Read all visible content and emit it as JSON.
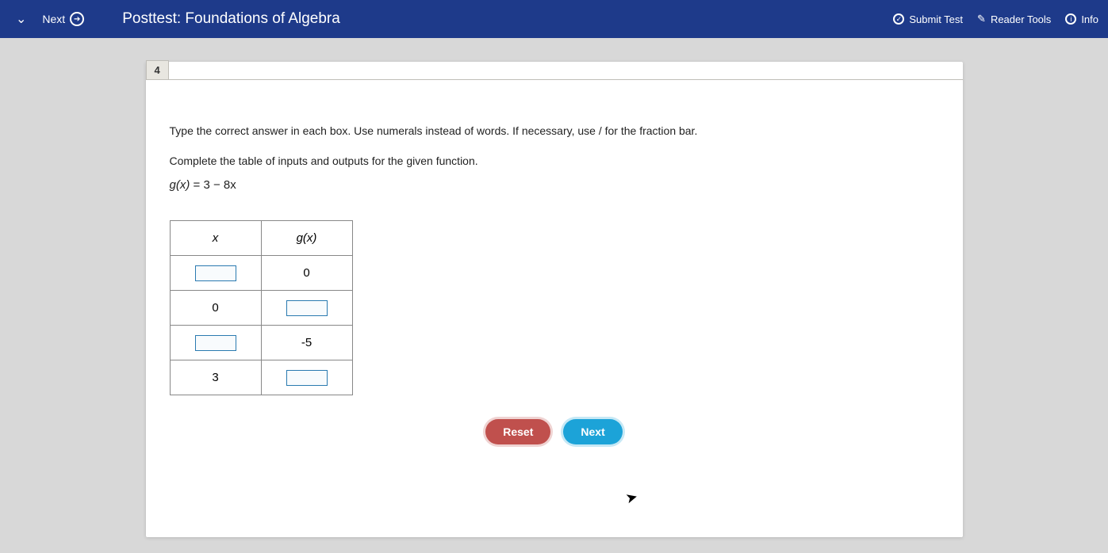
{
  "topbar": {
    "next_label": "Next",
    "title": "Posttest: Foundations of Algebra",
    "submit": "Submit Test",
    "reader": "Reader Tools",
    "info": "Info"
  },
  "question": {
    "number": "4",
    "instructions": "Type the correct answer in each box. Use numerals instead of words. If necessary, use / for the fraction bar.",
    "prompt": "Complete the table of inputs and outputs for the given function.",
    "formula_lhs": "g(x)",
    "formula_eq": " = ",
    "formula_rhs": "3 − 8x",
    "table": {
      "header_x": "x",
      "header_gx": "g(x)",
      "rows": [
        {
          "x_val": "",
          "x_input": true,
          "gx_val": "0",
          "gx_input": false
        },
        {
          "x_val": "0",
          "x_input": false,
          "gx_val": "",
          "gx_input": true
        },
        {
          "x_val": "",
          "x_input": true,
          "gx_val": "-5",
          "gx_input": false
        },
        {
          "x_val": "3",
          "x_input": false,
          "gx_val": "",
          "gx_input": true
        }
      ]
    },
    "buttons": {
      "reset": "Reset",
      "next": "Next"
    }
  }
}
